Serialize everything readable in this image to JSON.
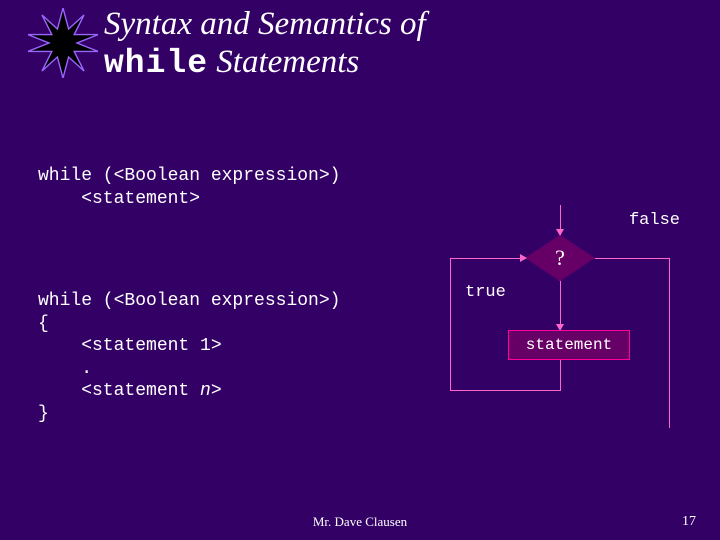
{
  "title": {
    "line1": "Syntax and Semantics of",
    "mono": "while",
    "line2_tail": " Statements"
  },
  "code1": {
    "l1": "while (<Boolean expression>)",
    "l2": "    <statement>"
  },
  "code2": {
    "l1": "while (<Boolean expression>)",
    "l2": "{",
    "l3": "    <statement 1>",
    "l4": "    .",
    "l5_a": "    <statement ",
    "l5_b": "n",
    "l5_c": ">",
    "l6": "}"
  },
  "flow": {
    "false": "false",
    "true": "true",
    "q": "?",
    "stmt": "statement"
  },
  "footer": {
    "author": "Mr. Dave Clausen",
    "page": "17"
  }
}
